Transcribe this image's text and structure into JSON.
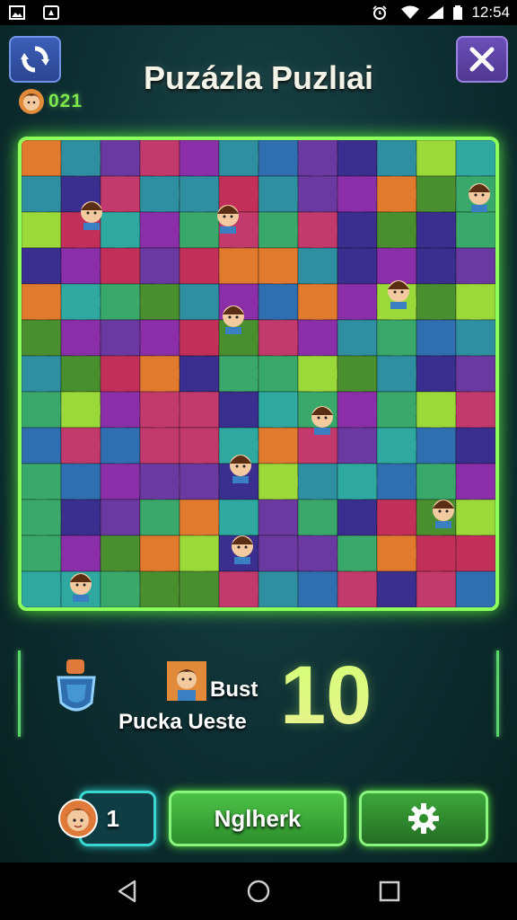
{
  "status_bar": {
    "time": "12:54"
  },
  "header": {
    "title": "Puzázla Puzlıai"
  },
  "score": {
    "value": "021"
  },
  "info_panel": {
    "line1": "Bust",
    "line2": "Pucka Ueste",
    "big_number": "10"
  },
  "bottom": {
    "count": "1",
    "main_button": "Nglherk"
  },
  "colors": {
    "accent_green": "#8dff5c",
    "piece_palette": [
      "#6b3aa0",
      "#3a2f8f",
      "#2f8fa0",
      "#3aa86b",
      "#c23a6b",
      "#e07a2f",
      "#2f6fb0",
      "#8a2fa8",
      "#9bd83a",
      "#c2305a",
      "#4a8f2f",
      "#2fa8a0"
    ]
  },
  "icons": [
    "refresh-icon",
    "close-icon",
    "avatar-icon",
    "shield-icon",
    "gear-icon",
    "back-icon",
    "home-icon",
    "recents-icon"
  ]
}
